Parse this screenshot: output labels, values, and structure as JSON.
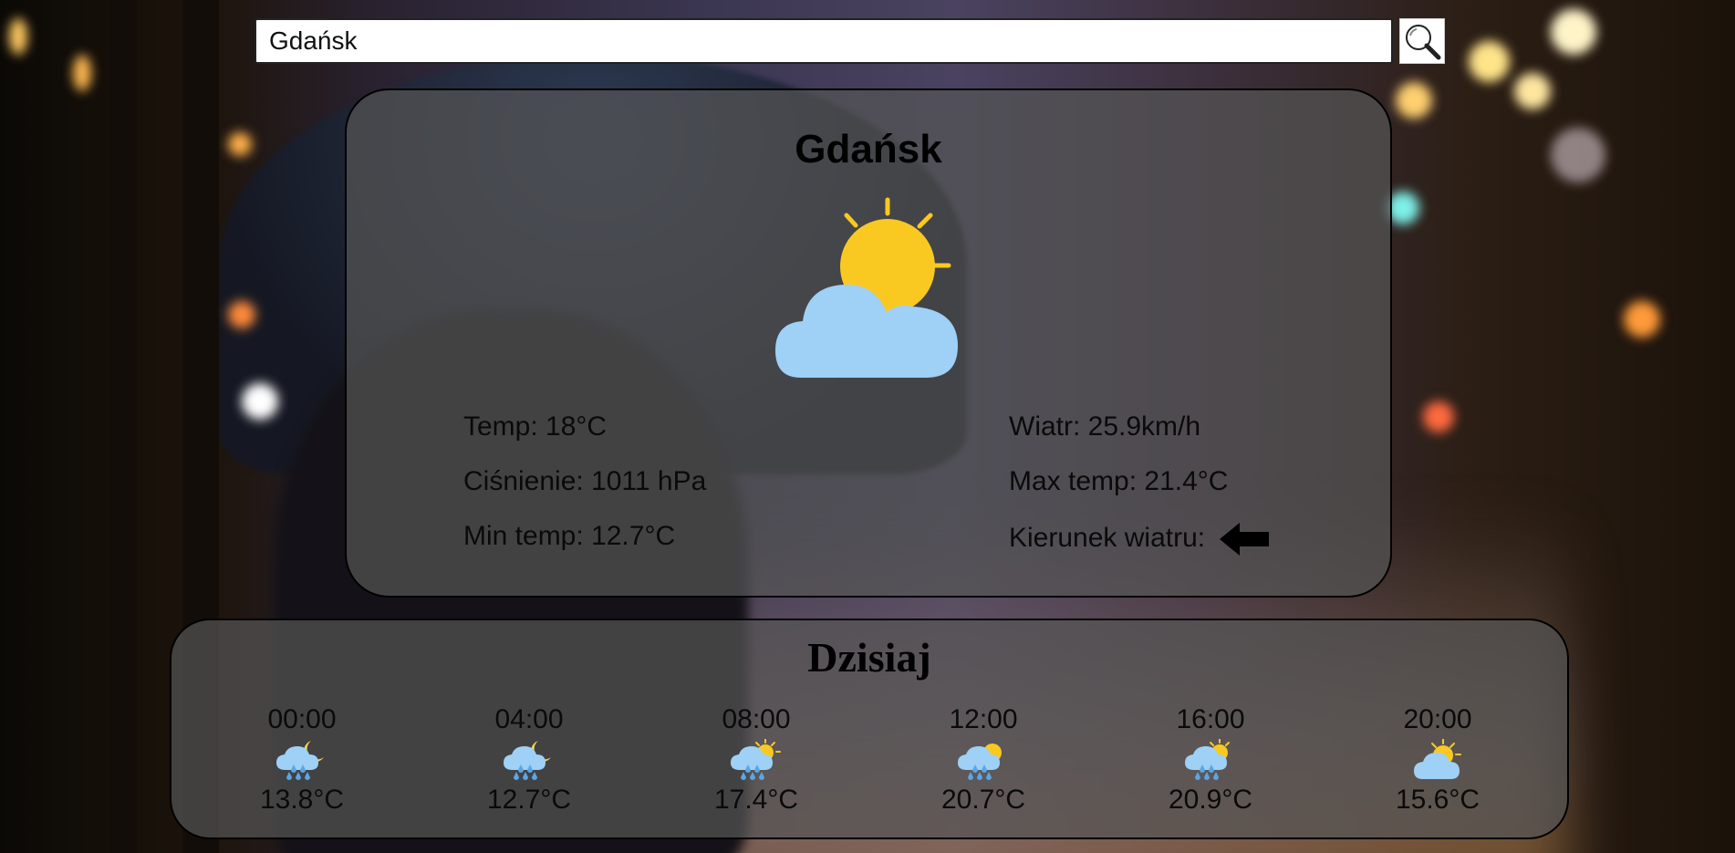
{
  "search": {
    "value": "Gdańsk",
    "button_icon": "magnifier-icon"
  },
  "current": {
    "city": "Gdańsk",
    "icon": "sun-behind-cloud-icon",
    "stats": [
      {
        "label": "Temp:",
        "value": "18°C"
      },
      {
        "label": "Ciśnienie:",
        "value": "1011 hPa"
      },
      {
        "label": "Min temp:",
        "value": "12.7°C"
      },
      {
        "label": "Wiatr:",
        "value": "25.9km/h"
      },
      {
        "label": "Max temp:",
        "value": "21.4°C"
      },
      {
        "label": "Kierunek wiatru:",
        "value": "",
        "icon": "arrow-left-icon"
      }
    ]
  },
  "forecast": {
    "title": "Dzisiaj",
    "slots": [
      {
        "time": "00:00",
        "temp": "13.8°C",
        "icon": "moon-rain-icon"
      },
      {
        "time": "04:00",
        "temp": "12.7°C",
        "icon": "moon-rain-icon"
      },
      {
        "time": "08:00",
        "temp": "17.4°C",
        "icon": "sun-rain-icon"
      },
      {
        "time": "12:00",
        "temp": "20.7°C",
        "icon": "sun-rain-icon"
      },
      {
        "time": "16:00",
        "temp": "20.9°C",
        "icon": "sun-rain-icon"
      },
      {
        "time": "20:00",
        "temp": "15.6°C",
        "icon": "sun-cloud-icon"
      }
    ]
  },
  "colors": {
    "sun": "#f9c922",
    "cloud": "#9fd0f5",
    "rain": "#5aa6e6",
    "moon": "#f5d84a",
    "card": "#555555"
  }
}
